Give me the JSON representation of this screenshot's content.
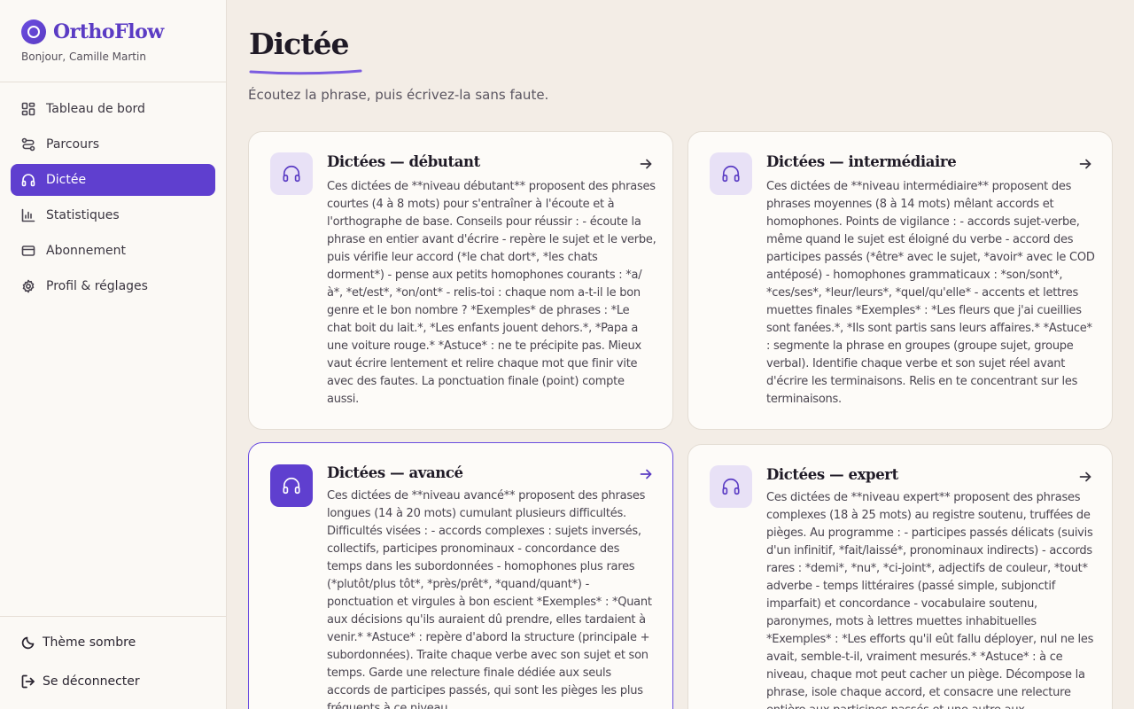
{
  "app": {
    "name": "OrthoFlow",
    "greeting": "Bonjour, Camille Martin"
  },
  "colors": {
    "accent": "#5f3fcf",
    "accent_soft": "#e8e1f6",
    "background": "#f3ede6",
    "sidebar": "#fbf9f5"
  },
  "nav": {
    "items": [
      {
        "label": "Tableau de bord",
        "icon": "dashboard-icon"
      },
      {
        "label": "Parcours",
        "icon": "route-icon"
      },
      {
        "label": "Dictée",
        "icon": "headphones-icon",
        "active": true
      },
      {
        "label": "Statistiques",
        "icon": "chart-icon"
      },
      {
        "label": "Abonnement",
        "icon": "credit-card-icon"
      },
      {
        "label": "Profil & réglages",
        "icon": "gear-icon"
      }
    ]
  },
  "footer": {
    "theme_label": "Thème sombre",
    "logout_label": "Se déconnecter"
  },
  "page": {
    "title": "Dictée",
    "subtitle": "Écoutez la phrase, puis écrivez-la sans faute."
  },
  "cards": [
    {
      "title": "Dictées — débutant",
      "icon": "headphones-icon",
      "description": "Ces dictées de **niveau débutant** proposent des phrases courtes (4 à 8 mots) pour s'entraîner à l'écoute et à l'orthographe de base. Conseils pour réussir : - écoute la phrase en entier avant d'écrire - repère le sujet et le verbe, puis vérifie leur accord (*le chat dort*, *les chats dorment*) - pense aux petits homophones courants : *a/à*, *et/est*, *on/ont* - relis-toi : chaque nom a-t-il le bon genre et le bon nombre ? *Exemples* de phrases : *Le chat boit du lait.*, *Les enfants jouent dehors.*, *Papa a une voiture rouge.* *Astuce* : ne te précipite pas. Mieux vaut écrire lentement et relire chaque mot que finir vite avec des fautes. La ponctuation finale (point) compte aussi."
    },
    {
      "title": "Dictées — intermédiaire",
      "icon": "headphones-icon",
      "description": "Ces dictées de **niveau intermédiaire** proposent des phrases moyennes (8 à 14 mots) mêlant accords et homophones. Points de vigilance : - accords sujet-verbe, même quand le sujet est éloigné du verbe - accord des participes passés (*être* avec le sujet, *avoir* avec le COD antéposé) - homophones grammaticaux : *son/sont*, *ces/ses*, *leur/leurs*, *quel/qu'elle* - accents et lettres muettes finales *Exemples* : *Les fleurs que j'ai cueillies sont fanées.*, *Ils sont partis sans leurs affaires.* *Astuce* : segmente la phrase en groupes (groupe sujet, groupe verbal). Identifie chaque verbe et son sujet réel avant d'écrire les terminaisons. Relis en te concentrant sur les terminaisons."
    },
    {
      "title": "Dictées — avancé",
      "icon": "headphones-icon",
      "highlight": true,
      "description": "Ces dictées de **niveau avancé** proposent des phrases longues (14 à 20 mots) cumulant plusieurs difficultés. Difficultés visées : - accords complexes : sujets inversés, collectifs, participes pronominaux - concordance des temps dans les subordonnées - homophones plus rares (*plutôt/plus tôt*, *près/prêt*, *quand/quant*) - ponctuation et virgules à bon escient *Exemples* : *Quant aux décisions qu'ils auraient dû prendre, elles tardaient à venir.* *Astuce* : repère d'abord la structure (principale + subordonnées). Traite chaque verbe avec son sujet et son temps. Garde une relecture finale dédiée aux seuls accords de participes passés, qui sont les pièges les plus fréquents à ce niveau."
    },
    {
      "title": "Dictées — expert",
      "icon": "headphones-icon",
      "description": "Ces dictées de **niveau expert** proposent des phrases complexes (18 à 25 mots) au registre soutenu, truffées de pièges. Au programme : - participes passés délicats (suivis d'un infinitif, *fait/laissé*, pronominaux indirects) - accords rares : *demi*, *nu*, *ci-joint*, adjectifs de couleur, *tout* adverbe - temps littéraires (passé simple, subjonctif imparfait) et concordance - vocabulaire soutenu, paronymes, mots à lettres muettes inhabituelles *Exemples* : *Les efforts qu'il eût fallu déployer, nul ne les avait, semble-t-il, vraiment mesurés.* *Astuce* : à ce niveau, chaque mot peut cacher un piège. Décompose la phrase, isole chaque accord, et consacre une relecture entière aux participes passés et une autre aux"
    }
  ]
}
